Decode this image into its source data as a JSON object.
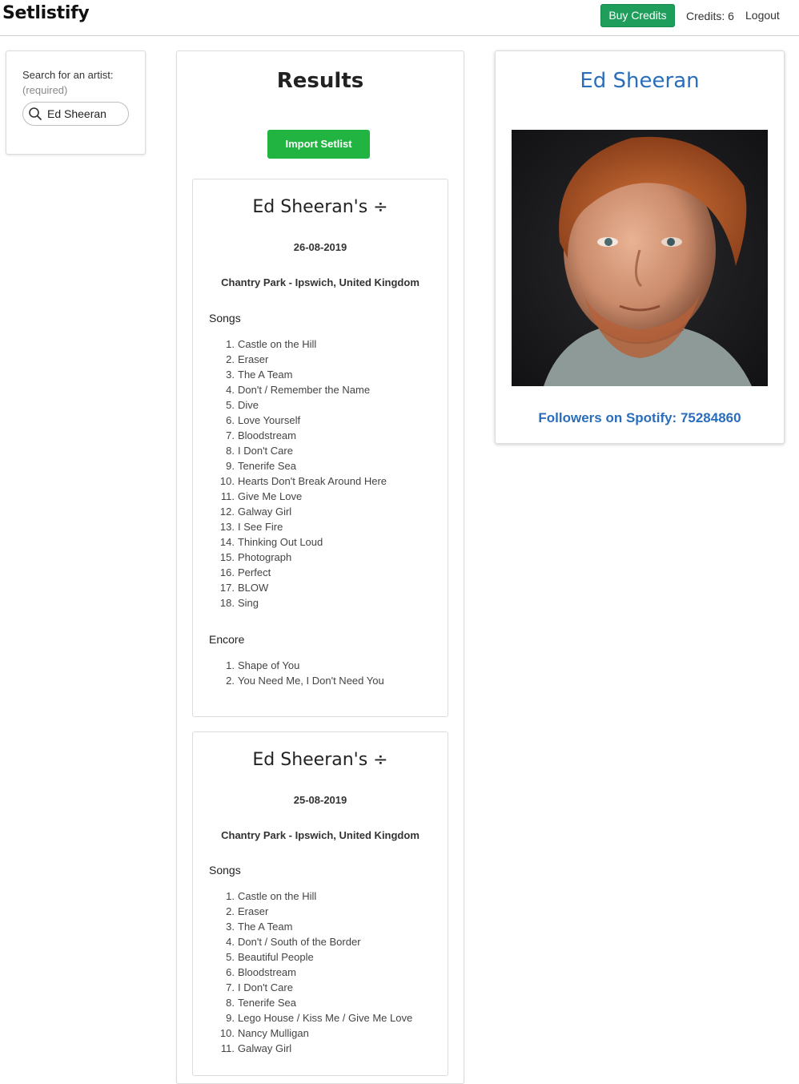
{
  "app": {
    "brand": "Setlistify",
    "buy_credits_label": "Buy Credits",
    "credits_text": "Credits: 6",
    "logout_label": "Logout"
  },
  "search": {
    "label": "Search for an artist:",
    "required": "(required)",
    "value": "Ed Sheeran"
  },
  "results": {
    "title": "Results",
    "import_label": "Import Setlist",
    "setlists": [
      {
        "title": "Ed Sheeran's ÷",
        "date": "26-08-2019",
        "venue": "Chantry Park - Ipswich, United Kingdom",
        "songs_heading": "Songs",
        "songs": [
          "Castle on the Hill",
          "Eraser",
          "The A Team",
          "Don't / Remember the Name",
          "Dive",
          "Love Yourself",
          "Bloodstream",
          "I Don't Care",
          "Tenerife Sea",
          "Hearts Don't Break Around Here",
          "Give Me Love",
          "Galway Girl",
          "I See Fire",
          "Thinking Out Loud",
          "Photograph",
          "Perfect",
          "BLOW",
          "Sing"
        ],
        "encore_heading": "Encore",
        "encore": [
          "Shape of You",
          "You Need Me, I Don't Need You"
        ]
      },
      {
        "title": "Ed Sheeran's ÷",
        "date": "25-08-2019",
        "venue": "Chantry Park - Ipswich, United Kingdom",
        "songs_heading": "Songs",
        "songs": [
          "Castle on the Hill",
          "Eraser",
          "The A Team",
          "Don't / South of the Border",
          "Beautiful People",
          "Bloodstream",
          "I Don't Care",
          "Tenerife Sea",
          "Lego House / Kiss Me / Give Me Love",
          "Nancy Mulligan",
          "Galway Girl"
        ]
      }
    ]
  },
  "artist": {
    "name": "Ed Sheeran",
    "followers_text": "Followers on Spotify: 75284860"
  },
  "colors": {
    "buy_button": "#1e9e5a",
    "import_button": "#22b440",
    "artist_accent": "#2a6ebb"
  }
}
